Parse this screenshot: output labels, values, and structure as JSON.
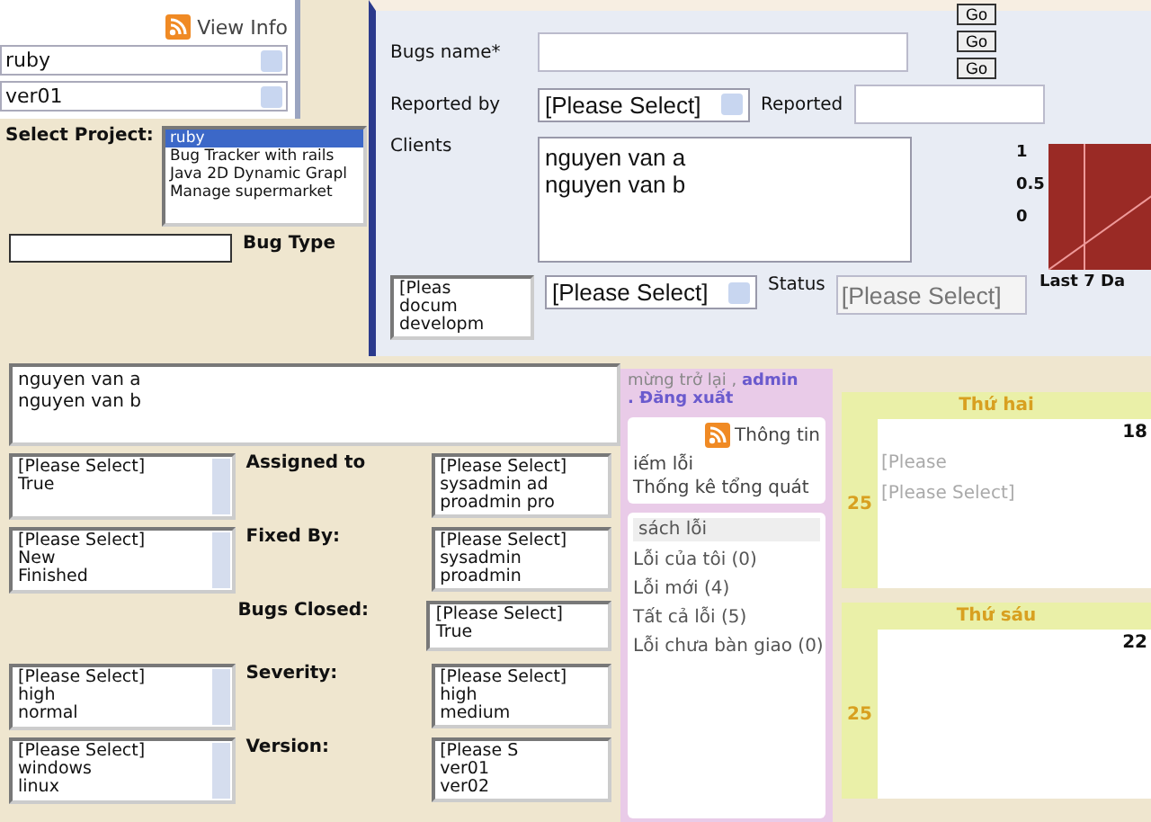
{
  "top_left_panel": {
    "view_info": "View Info",
    "project_select": "ruby",
    "version_select": "ver01"
  },
  "select_project": {
    "label": "Select Project:",
    "options": [
      {
        "label": "ruby",
        "selected": true
      },
      {
        "label": "Bug Tracker with rails",
        "selected": false
      },
      {
        "label": "Java 2D Dynamic Grapl",
        "selected": false
      },
      {
        "label": "Manage supermarket",
        "selected": false
      }
    ]
  },
  "bug_type": {
    "label": "Bug Type",
    "options": [
      "[Pleas",
      "docum",
      "developm"
    ]
  },
  "clients_box": {
    "lines": [
      "nguyen van a",
      "nguyen van b"
    ]
  },
  "rows": [
    {
      "left_options": [
        "[Please Select]",
        "True"
      ],
      "label": "Assigned to",
      "right_options": [
        "[Please Select]",
        "sysadmin ad",
        "proadmin pro"
      ]
    },
    {
      "left_options": [
        "[Please Select]",
        "New",
        "Finished"
      ],
      "label": "Fixed By:",
      "right_options": [
        "[Please Select]",
        "sysadmin",
        "proadmin"
      ]
    },
    {
      "left_options": [],
      "label": "Bugs Closed:",
      "right_options": [
        "[Please Select]",
        "True"
      ]
    },
    {
      "left_options": [
        "[Please Select]",
        "high",
        "normal"
      ],
      "label": "Severity:",
      "right_options": [
        "[Please Select]",
        "high",
        "medium"
      ]
    },
    {
      "left_options": [
        "[Please Select]",
        "windows",
        "linux"
      ],
      "label": "Version:",
      "right_options": [
        "[Please S",
        "ver01",
        "ver02"
      ]
    }
  ],
  "bug_form": {
    "bugs_name_label": "Bugs name*",
    "reported_by_label": "Reported by",
    "reported_by_value": "[Please Select]",
    "reported_label": "Reported",
    "clients_label": "Clients",
    "clients": [
      "nguyen van a",
      "nguyen van b"
    ],
    "type_value": "[Please Select]",
    "status_label": "Status",
    "status_placeholder": "[Please Select]"
  },
  "menu_panel": {
    "welcome": "mừng trở lại ,",
    "user_link": "admin",
    "logout_link": ". Đăng xuất",
    "info_link": "Thông tin",
    "tabs": [
      "iếm lỗi",
      "Thống kê tổng quát"
    ],
    "list_title": "sách lỗi",
    "items": [
      "Lỗi của tôi (0)",
      "Lỗi mới (4)",
      "Tất cả lỗi (5)",
      "Lỗi chưa bàn giao (0)"
    ]
  },
  "calendar": {
    "days": [
      {
        "name": "Thứ hai",
        "date": "18",
        "week": "25",
        "entries": [
          "[Please",
          "[Please Select]"
        ]
      },
      {
        "name": "Thứ sáu",
        "date": "22",
        "week": "25"
      }
    ]
  },
  "dashboard": {
    "go_buttons": [
      "Go",
      "Go",
      "Go"
    ],
    "axis_labels": [
      "1",
      "0.5",
      "0"
    ],
    "caption": "Last 7 Da"
  }
}
